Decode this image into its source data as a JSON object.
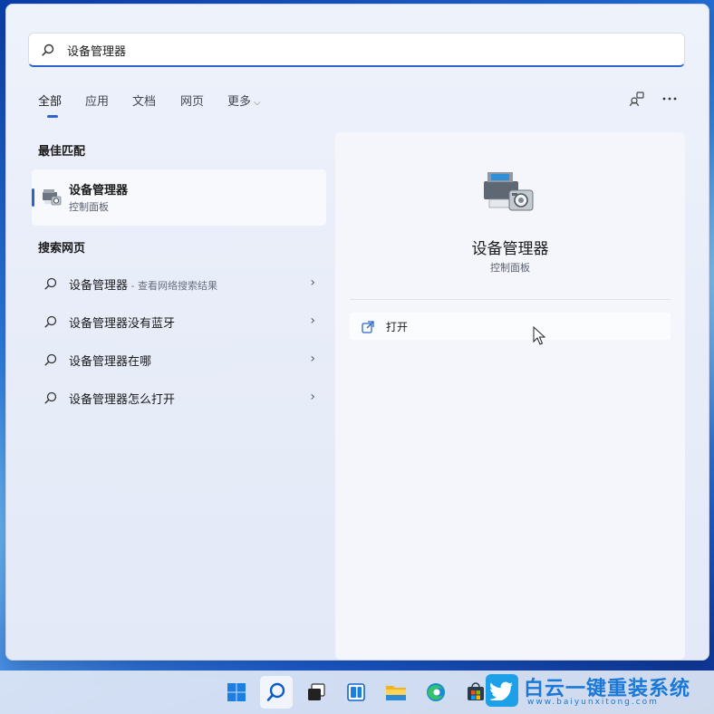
{
  "search": {
    "value": "设备管理器"
  },
  "tabs": [
    "全部",
    "应用",
    "文档",
    "网页",
    "更多"
  ],
  "best_match": {
    "section_title": "最佳匹配",
    "name": "设备管理器",
    "category": "控制面板"
  },
  "web_search": {
    "section_title": "搜索网页",
    "items": [
      {
        "label": "设备管理器",
        "hint": " - 查看网络搜索结果"
      },
      {
        "label": "设备管理器没有蓝牙",
        "hint": ""
      },
      {
        "label": "设备管理器在哪",
        "hint": ""
      },
      {
        "label": "设备管理器怎么打开",
        "hint": ""
      }
    ]
  },
  "preview": {
    "title": "设备管理器",
    "subtitle": "控制面板",
    "action_open": "打开"
  },
  "watermark": {
    "text": "白云一键重装系统",
    "url": "www.baiyunxitong.com"
  },
  "colors": {
    "accent": "#2f64c9"
  }
}
